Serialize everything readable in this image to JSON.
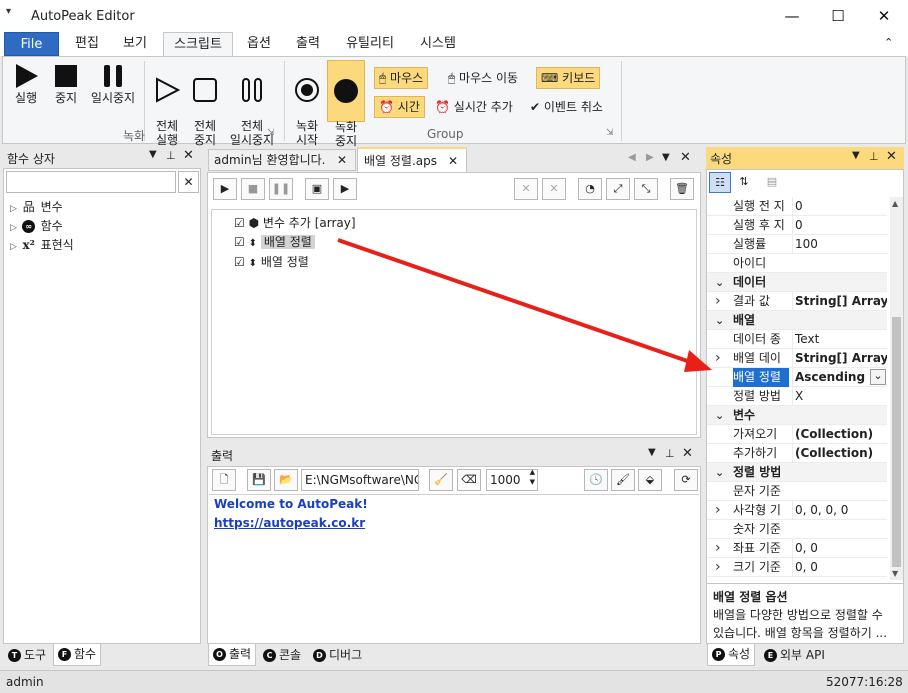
{
  "window": {
    "title": "AutoPeak Editor",
    "controls": {
      "minimize": "—",
      "maximize": "☐",
      "close": "✕"
    }
  },
  "ribbon_tabs": [
    "File",
    "편집",
    "보기",
    "스크립트",
    "옵션",
    "출력",
    "유틸리티",
    "시스템"
  ],
  "ribbon": {
    "record_group": {
      "label": "녹화",
      "buttons": [
        {
          "label": "실행",
          "icon": "play-icon"
        },
        {
          "label": "중지",
          "icon": "stop-icon"
        },
        {
          "label": "일시중지",
          "icon": "pause-icon"
        },
        {
          "label": "전체\n실행",
          "icon": "play-outline-icon"
        },
        {
          "label": "전체\n중지",
          "icon": "stop-outline-icon"
        },
        {
          "label": "전체\n일시중지",
          "icon": "pause-outline-icon"
        }
      ]
    },
    "group2": {
      "label": "Group",
      "buttons": [
        {
          "label": "녹화\n시작",
          "icon": "record-icon"
        },
        {
          "label": "녹화\n중지",
          "icon": "record-stop-icon"
        }
      ],
      "toggles": [
        {
          "label": "마우스",
          "icon": "mouse-icon",
          "on": true
        },
        {
          "label": "마우스 이동",
          "icon": "mouse-move-icon",
          "on": false
        },
        {
          "label": "키보드",
          "icon": "keyboard-icon",
          "on": true
        },
        {
          "label": "시간",
          "icon": "clock-icon",
          "on": true
        },
        {
          "label": "실시간 추가",
          "icon": "realtime-icon",
          "on": false
        },
        {
          "label": "이벤트 취소",
          "icon": "cancel-event-icon",
          "on": false
        }
      ]
    }
  },
  "left_panel": {
    "title": "함수 상자",
    "search_value": "",
    "tree": [
      {
        "label": "변수",
        "icon": "variable-icon"
      },
      {
        "label": "함수",
        "icon": "function-icon"
      },
      {
        "label": "표현식",
        "icon": "expression-icon"
      }
    ],
    "bottom_tabs": [
      {
        "label": "도구",
        "badge": "T"
      },
      {
        "label": "함수",
        "badge": "F"
      }
    ]
  },
  "editor": {
    "tabs": [
      {
        "label": "admin님 환영합니다."
      },
      {
        "label": "배열 정렬.aps"
      }
    ],
    "nodes": [
      {
        "label": "변수 추가 [array]",
        "checked": true,
        "selected": false
      },
      {
        "label": "배열 정렬",
        "checked": true,
        "selected": true
      },
      {
        "label": "배열 정렬",
        "checked": true,
        "selected": false
      }
    ]
  },
  "output": {
    "title": "출력",
    "path": "E:\\NGMsoftware\\NG",
    "count": "1000",
    "lines": [
      {
        "text": "Welcome to AutoPeak!"
      },
      {
        "text": "https://autopeak.co.kr"
      }
    ],
    "bottom_tabs": [
      {
        "label": "출력",
        "badge": "O"
      },
      {
        "label": "콘솔",
        "badge": "C"
      },
      {
        "label": "디버그",
        "badge": "D"
      }
    ]
  },
  "properties": {
    "title": "속성",
    "rows": [
      {
        "key": "실행 전 지",
        "value": "0"
      },
      {
        "key": "실행 후 지",
        "value": "0"
      },
      {
        "key": "실행률",
        "value": "100"
      },
      {
        "key": "아이디",
        "value": ""
      },
      {
        "cat": "데이터"
      },
      {
        "key": "결과 값",
        "value": "String[] Array",
        "expand": true,
        "bold": true
      },
      {
        "cat": "배열"
      },
      {
        "key": "데이터 종",
        "value": "Text"
      },
      {
        "key": "배열 데이",
        "value": "String[] Array",
        "expand": true,
        "bold": true
      },
      {
        "key": "배열 정렬",
        "value": "Ascending",
        "selected": true,
        "bold": true
      },
      {
        "key": "정렬 방법",
        "value": "X"
      },
      {
        "cat": "변수"
      },
      {
        "key": "가져오기",
        "value": "(Collection)",
        "bold": true
      },
      {
        "key": "추가하기",
        "value": "(Collection)",
        "bold": true
      },
      {
        "cat": "정렬 방법"
      },
      {
        "key": "문자 기준",
        "value": ""
      },
      {
        "key": "사각형 기",
        "value": "0, 0, 0, 0",
        "expand": true
      },
      {
        "key": "숫자 기준",
        "value": ""
      },
      {
        "key": "좌표 기준",
        "value": "0, 0",
        "expand": true
      },
      {
        "key": "크기 기준",
        "value": "0, 0",
        "expand": true
      }
    ],
    "desc_title": "배열 정렬 옵션",
    "desc_text": "배열을 다양한 방법으로 정렬할 수 있습니다. 배열 항목을 정렬하기 ...",
    "bottom_tabs": [
      {
        "label": "속성",
        "badge": "P"
      },
      {
        "label": "외부 API",
        "badge": "E"
      }
    ]
  },
  "statusbar": {
    "user": "admin",
    "time": "52077:16:28"
  },
  "colors": {
    "accent": "#2e6cc4",
    "highlight": "#fbd97c",
    "selection": "#1f6fd1",
    "link": "#1a3fbf",
    "arrow": "#e8201a"
  }
}
